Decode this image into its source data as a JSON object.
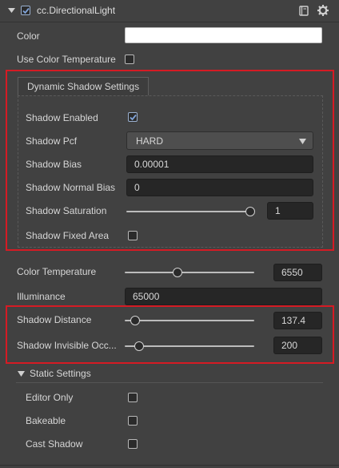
{
  "component": {
    "title": "cc.DirectionalLight",
    "enabled": true
  },
  "props": {
    "color_label": "Color",
    "color_value": "#ffffff",
    "use_color_temp_label": "Use Color Temperature",
    "use_color_temp_checked": false
  },
  "shadow_settings": {
    "tab_label": "Dynamic Shadow Settings",
    "enabled_label": "Shadow Enabled",
    "enabled_checked": true,
    "pcf_label": "Shadow Pcf",
    "pcf_value": "HARD",
    "bias_label": "Shadow Bias",
    "bias_value": "0.00001",
    "normal_bias_label": "Shadow Normal Bias",
    "normal_bias_value": "0",
    "saturation_label": "Shadow Saturation",
    "saturation_value": "1",
    "saturation_level": 1.0,
    "fixed_area_label": "Shadow Fixed Area",
    "fixed_area_checked": false
  },
  "light": {
    "color_temp_label": "Color Temperature",
    "color_temp_value": "6550",
    "color_temp_level": 0.42,
    "illuminance_label": "Illuminance",
    "illuminance_value": "65000"
  },
  "shadow_range": {
    "distance_label": "Shadow Distance",
    "distance_value": "137.4",
    "distance_level": 0.07,
    "invisible_label": "Shadow Invisible Occ...",
    "invisible_value": "200",
    "invisible_level": 0.1
  },
  "static_settings": {
    "header": "Static Settings",
    "editor_only_label": "Editor Only",
    "bakeable_label": "Bakeable",
    "cast_shadow_label": "Cast Shadow"
  },
  "colors": {
    "highlight_border": "#d51b24",
    "checkbox_accent": "#7fa3d9"
  }
}
